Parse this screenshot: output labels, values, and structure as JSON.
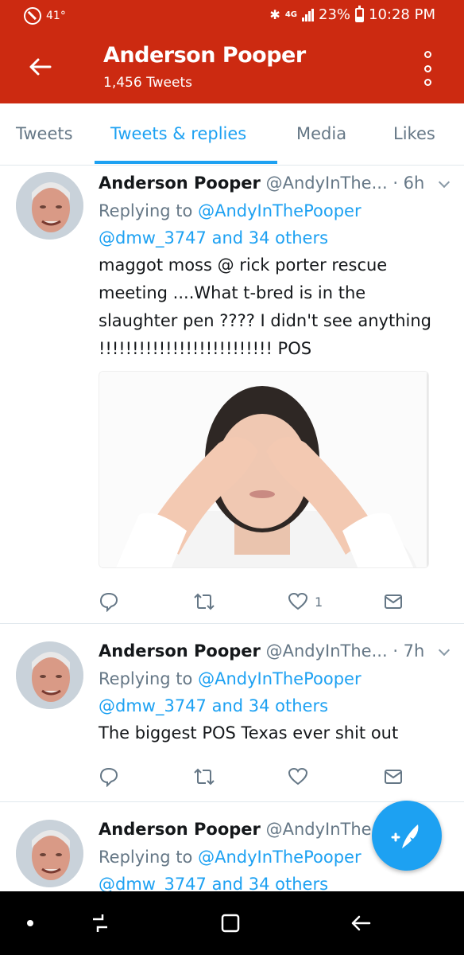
{
  "status_bar": {
    "temperature": "41°",
    "network": "4G",
    "battery": "23%",
    "time": "10:28 PM"
  },
  "header": {
    "title": "Anderson Pooper",
    "subtitle": "1,456 Tweets"
  },
  "tabs": [
    {
      "label": "Tweets",
      "active": false
    },
    {
      "label": "Tweets & replies",
      "active": true
    },
    {
      "label": "Media",
      "active": false
    },
    {
      "label": "Likes",
      "active": false
    }
  ],
  "tweets": [
    {
      "name": "Anderson Pooper",
      "handle": "@AndyInThe...",
      "time": "· 6h",
      "replying_prefix": "Replying to",
      "replying_to": "@AndyInThePooper",
      "replying_more": "@dmw_3747 and 34 others",
      "text": "maggot moss @ rick porter rescue meeting ....What t-bred is in the slaughter pen ???? I didn't see anything !!!!!!!!!!!!!!!!!!!!!!!!!!  POS",
      "has_media": true,
      "likes": "1"
    },
    {
      "name": "Anderson Pooper",
      "handle": "@AndyInThe...",
      "time": "· 7h",
      "replying_prefix": "Replying to",
      "replying_to": "@AndyInThePooper",
      "replying_more": "@dmw_3747 and 34 others",
      "text": "The biggest POS Texas ever shit out",
      "has_media": false,
      "likes": ""
    },
    {
      "name": "Anderson Pooper",
      "handle": "@AndyInThe...",
      "time": "",
      "replying_prefix": "Replying to",
      "replying_to": "@AndyInThePooper",
      "replying_more": "@dmw_3747 and 34 others",
      "text": "",
      "has_media": false,
      "likes": ""
    }
  ],
  "colors": {
    "header_bg": "#cc2a11",
    "accent": "#1da1f2",
    "secondary_text": "#657786"
  },
  "icons": {
    "back": "arrow-left-icon",
    "more": "vertical-dots-icon",
    "reply": "reply-bubble-icon",
    "retweet": "retweet-icon",
    "like": "heart-icon",
    "dm": "envelope-icon",
    "compose": "compose-feather-icon"
  }
}
